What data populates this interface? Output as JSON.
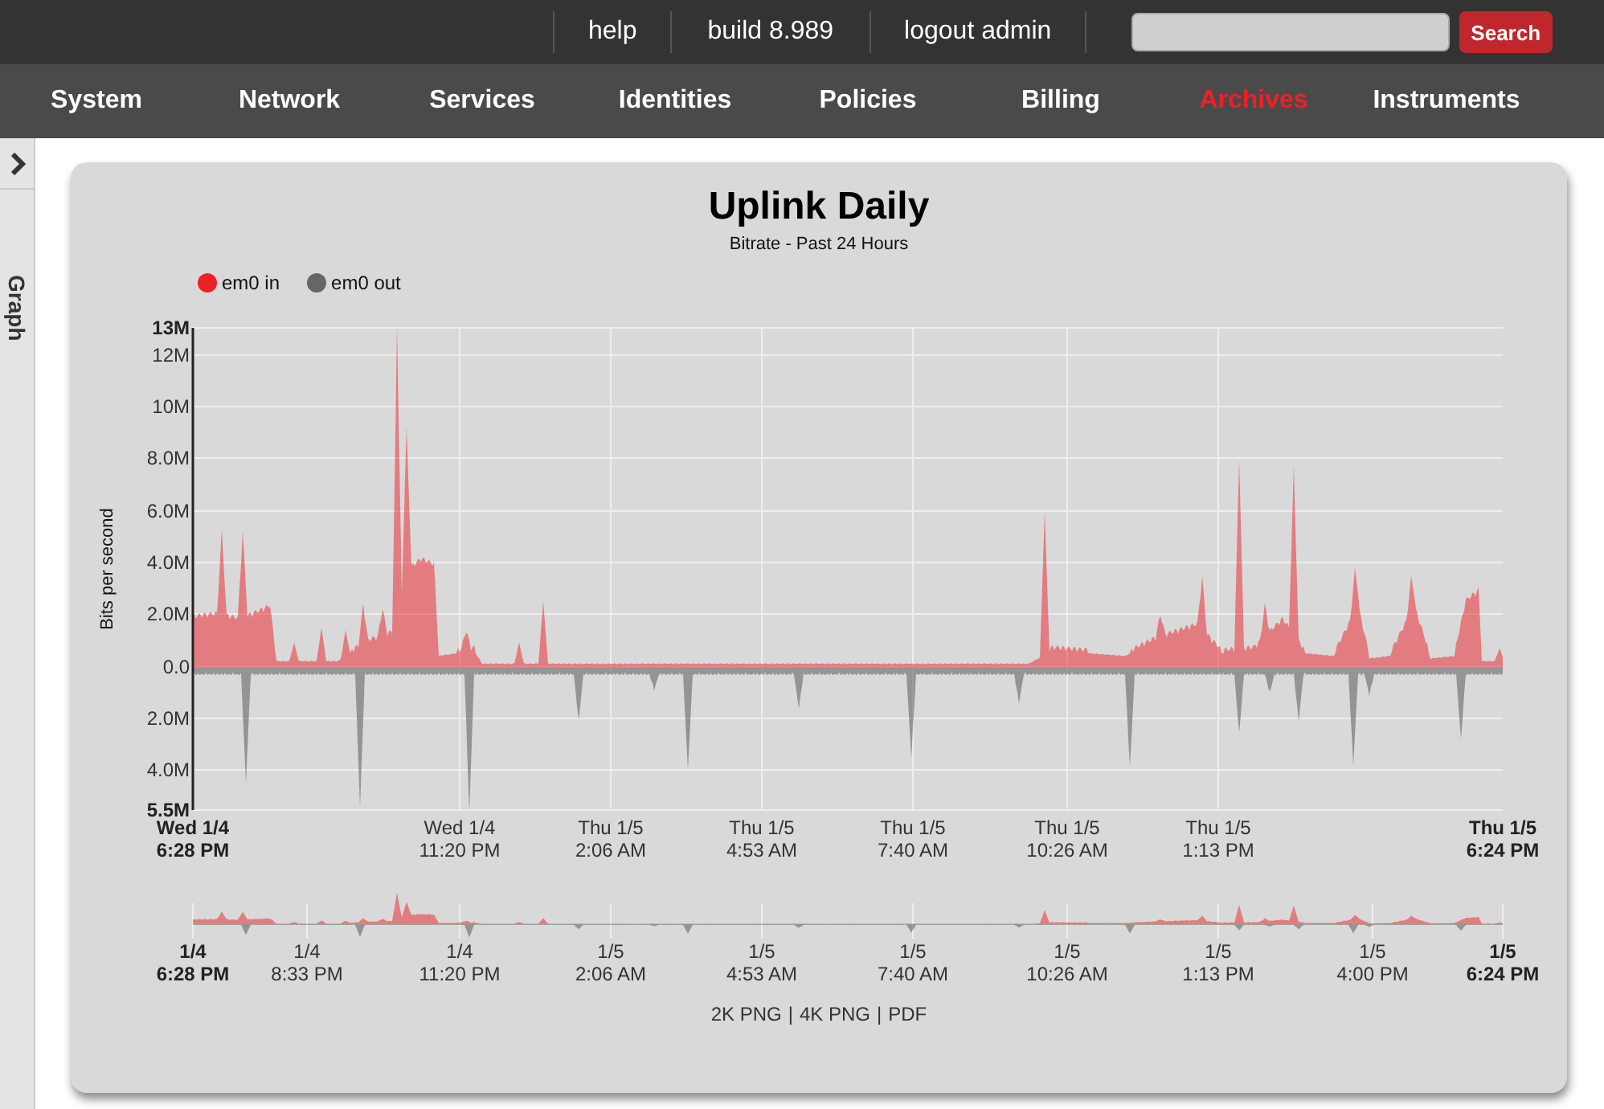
{
  "header": {
    "links": [
      {
        "label": "help"
      },
      {
        "label": "build 8.989"
      },
      {
        "label": "logout admin"
      }
    ],
    "search": {
      "button": "Search"
    }
  },
  "nav": [
    {
      "label": "System",
      "selected": false
    },
    {
      "label": "Network",
      "selected": false
    },
    {
      "label": "Services",
      "selected": false
    },
    {
      "label": "Identities",
      "selected": false
    },
    {
      "label": "Policies",
      "selected": false
    },
    {
      "label": "Billing",
      "selected": false
    },
    {
      "label": "Archives",
      "selected": true
    },
    {
      "label": "Instruments",
      "selected": false
    }
  ],
  "sidebar": {
    "label": "Graph"
  },
  "graph": {
    "title": "Uplink Daily",
    "subtitle": "Bitrate - Past 24 Hours",
    "legend": [
      {
        "label": "em0 in",
        "color": "#ee2027"
      },
      {
        "label": "em0 out",
        "color": "#666666"
      }
    ],
    "ylabel": "Bits per second",
    "yticks": [
      "13M",
      "12M",
      "10M",
      "8.0M",
      "6.0M",
      "4.0M",
      "2.0M",
      "0.0",
      "2.0M",
      "4.0M",
      "5.5M"
    ],
    "xticks": [
      {
        "day": "Wed 1/4",
        "time": "6:28 PM"
      },
      {
        "day": "Wed 1/4",
        "time": "11:20 PM"
      },
      {
        "day": "Thu 1/5",
        "time": "2:06 AM"
      },
      {
        "day": "Thu 1/5",
        "time": "4:53 AM"
      },
      {
        "day": "Thu 1/5",
        "time": "7:40 AM"
      },
      {
        "day": "Thu 1/5",
        "time": "10:26 AM"
      },
      {
        "day": "Thu 1/5",
        "time": "1:13 PM"
      },
      {
        "day": "Thu 1/5",
        "time": "6:24 PM"
      }
    ],
    "overview_xticks": [
      {
        "day": "1/4",
        "time": "6:28 PM"
      },
      {
        "day": "1/4",
        "time": "8:33 PM"
      },
      {
        "day": "1/4",
        "time": "11:20 PM"
      },
      {
        "day": "1/5",
        "time": "2:06 AM"
      },
      {
        "day": "1/5",
        "time": "4:53 AM"
      },
      {
        "day": "1/5",
        "time": "7:40 AM"
      },
      {
        "day": "1/5",
        "time": "10:26 AM"
      },
      {
        "day": "1/5",
        "time": "1:13 PM"
      },
      {
        "day": "1/5",
        "time": "4:00 PM"
      },
      {
        "day": "1/5",
        "time": "6:24 PM"
      }
    ],
    "exports": [
      {
        "label": "2K PNG"
      },
      {
        "label": "4K PNG"
      },
      {
        "label": "PDF"
      }
    ],
    "separator": "|"
  }
}
